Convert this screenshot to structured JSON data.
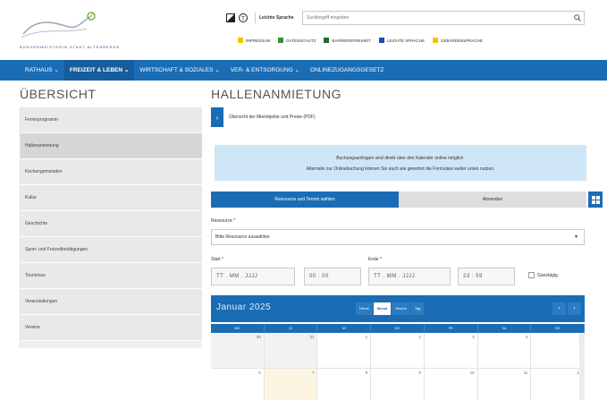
{
  "logo": {
    "caption": "BURGERMEISTERIN STADT ALTENBERGE"
  },
  "header": {
    "easy_language": "Leichte Sprache",
    "search_placeholder": "Suchbegriff eingeben",
    "quicklinks": [
      {
        "label": "IMPRESSUM",
        "color": "#f2c600"
      },
      {
        "label": "DATENSCHUTZ",
        "color": "#3a8e3a"
      },
      {
        "label": "BARRIEREFREIHEIT",
        "color": "#1f6b33"
      },
      {
        "label": "LEICHTE SPRACHE",
        "color": "#1a4fb0"
      },
      {
        "label": "GEBÄRDENSPRACHE",
        "color": "#f2c600"
      }
    ]
  },
  "nav": {
    "items": [
      {
        "label": "RATHAUS ⌄"
      },
      {
        "label": "FREIZEIT & LEBEN ⌄"
      },
      {
        "label": "WIRTSCHAFT & SOZIALES ⌄"
      },
      {
        "label": "VER- & ENTSORGUNG ⌄"
      },
      {
        "label": "ONLINEZUGANGSGESETZ"
      }
    ]
  },
  "sidebar": {
    "title": "ÜBERSICHT",
    "items": [
      {
        "label": "Ferienprogramm"
      },
      {
        "label": "Hallenanmietung"
      },
      {
        "label": "Kirchengemeinden"
      },
      {
        "label": "Kultur"
      },
      {
        "label": "Geschichte"
      },
      {
        "label": "Sport- und Freizeitbetätigungen"
      },
      {
        "label": "Tourismus"
      },
      {
        "label": "Veranstaltungen"
      },
      {
        "label": "Vereine"
      }
    ]
  },
  "main": {
    "title": "HALLENANMIETUNG",
    "pdf_link": "Übersicht der Mietobjekte und Preise (PDF)",
    "info_line1": "Buchungsanfragen sind direkt über den Kalender online möglich.",
    "info_line2": "Alternativ zur Onlinebuchung können Sie auch wie gewohnt die Formulare weiter unten nutzen.",
    "tab_active": "Ressource und Termin wählen",
    "tab_inactive": "Absenden",
    "resource_label": "Ressource *",
    "resource_value": "Bitte Ressource auswählen",
    "start_label": "Start *",
    "end_label": "Ende *",
    "start_date": "TT . MM . JJJJ",
    "start_time": "00 : 00",
    "end_date": "TT . MM . JJJJ",
    "end_time": "23 : 59",
    "allday": "Ganztägig"
  },
  "calendar": {
    "month": "Januar 2025",
    "views": [
      "Heute",
      "Monat",
      "Woche",
      "Tag"
    ],
    "weekdays": [
      "MO",
      "DI",
      "MI",
      "DO",
      "FR",
      "SA",
      "SO"
    ],
    "rows": [
      [
        "30",
        "31",
        "1",
        "2",
        "3",
        "4",
        "5"
      ],
      [
        "6",
        "7",
        "8",
        "9",
        "10",
        "11",
        "12"
      ]
    ]
  }
}
